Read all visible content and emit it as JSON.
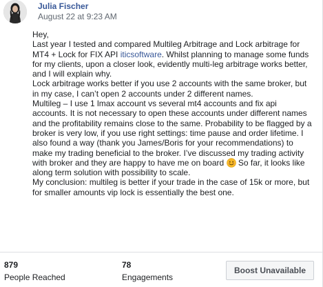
{
  "post": {
    "author": "Julia Fischer",
    "timestamp": "August 22 at 9:23 AM",
    "lines": {
      "l1": "Hey,",
      "l2": "Last year I tested and compared Multileg Arbitrage and Lock arbitrage for",
      "l3a": "MT4 + Lock for FIX API ",
      "l3link": "iticsoftware",
      "l3b": ". Whilst planning to manage some funds",
      "l4": "for my clients, upon a closer look, evidently multi-leg arbitrage works better,",
      "l5": "and I will explain why.",
      "l6": "Lock arbitrage works better if you use 2 accounts with the same broker, but",
      "l7": "in my case, I can’t open 2 accounts under 2 different names.",
      "l8": "Multileg – I use 1 lmax account vs several mt4 accounts and fix api",
      "l9": "accounts. It is not necessary to open these accounts under different names",
      "l10": "and the profitability remains close to the same. Probability to be flagged by a",
      "l11": "broker is very low, if you use right settings: time pause and order lifetime. I",
      "l12": "also found a way (thank you James/Boris for your recommendations) to",
      "l13": "make my trading beneficial to the broker. I’ve discussed my trading activity",
      "l14a": "with broker and they are happy to have me on board ",
      "l14b": " So far, it looks like",
      "l15": "along term solution with possibility to scale.",
      "l16": "My conclusion: multileg is better if your trade in the case of 15k or more, but",
      "l17": "for smaller amounts vip lock is essentially the best one."
    },
    "emoji_icon": "smiling-face-emoji",
    "colors": {
      "name": "#385898",
      "link": "#385898",
      "text": "#1c1e21"
    }
  },
  "stats": {
    "reached_value": "879",
    "reached_label": "People Reached",
    "engagements_value": "78",
    "engagements_label": "Engagements"
  },
  "actions": {
    "boost_label": "Boost Unavailable"
  }
}
